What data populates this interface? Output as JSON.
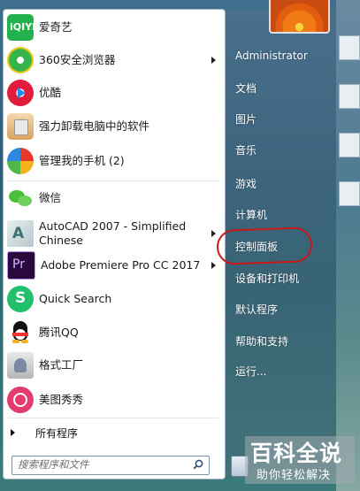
{
  "programs": [
    {
      "label": "爱奇艺",
      "icon": "iqiyi-icon",
      "arrow": false
    },
    {
      "label": "360安全浏览器",
      "icon": "360-browser-icon",
      "arrow": true
    },
    {
      "label": "优酷",
      "icon": "youku-icon",
      "arrow": false
    },
    {
      "label": "强力卸载电脑中的软件",
      "icon": "uninstall-icon",
      "arrow": false
    },
    {
      "label": "管理我的手机 (2)",
      "icon": "phone-manager-icon",
      "arrow": false
    },
    {
      "label": "微信",
      "icon": "wechat-icon",
      "arrow": false
    },
    {
      "label": "AutoCAD 2007 - Simplified",
      "label2": "Chinese",
      "icon": "autocad-icon",
      "arrow": true
    },
    {
      "label": "Adobe Premiere Pro CC 2017",
      "icon": "premiere-icon",
      "arrow": true
    },
    {
      "label": "Quick Search",
      "icon": "quick-search-icon",
      "arrow": false
    },
    {
      "label": "腾讯QQ",
      "icon": "qq-icon",
      "arrow": false
    },
    {
      "label": "格式工厂",
      "icon": "format-factory-icon",
      "arrow": false
    },
    {
      "label": "美图秀秀",
      "icon": "meitu-icon",
      "arrow": false
    }
  ],
  "all_programs": "所有程序",
  "search": {
    "placeholder": "搜索程序和文件"
  },
  "right_panel": [
    {
      "label": "Administrator"
    },
    {
      "label": "文档"
    },
    {
      "label": "图片"
    },
    {
      "label": "音乐"
    },
    {
      "label": "游戏"
    },
    {
      "label": "计算机"
    },
    {
      "label": "控制面板"
    },
    {
      "label": "设备和打印机"
    },
    {
      "label": "默认程序"
    },
    {
      "label": "帮助和支持"
    },
    {
      "label": "运行..."
    }
  ],
  "watermark": {
    "title": "百科全说",
    "subtitle": "助你轻松解决"
  },
  "colors": {
    "highlight_circle": "#c91919",
    "menu_bg": "#ffffff"
  }
}
